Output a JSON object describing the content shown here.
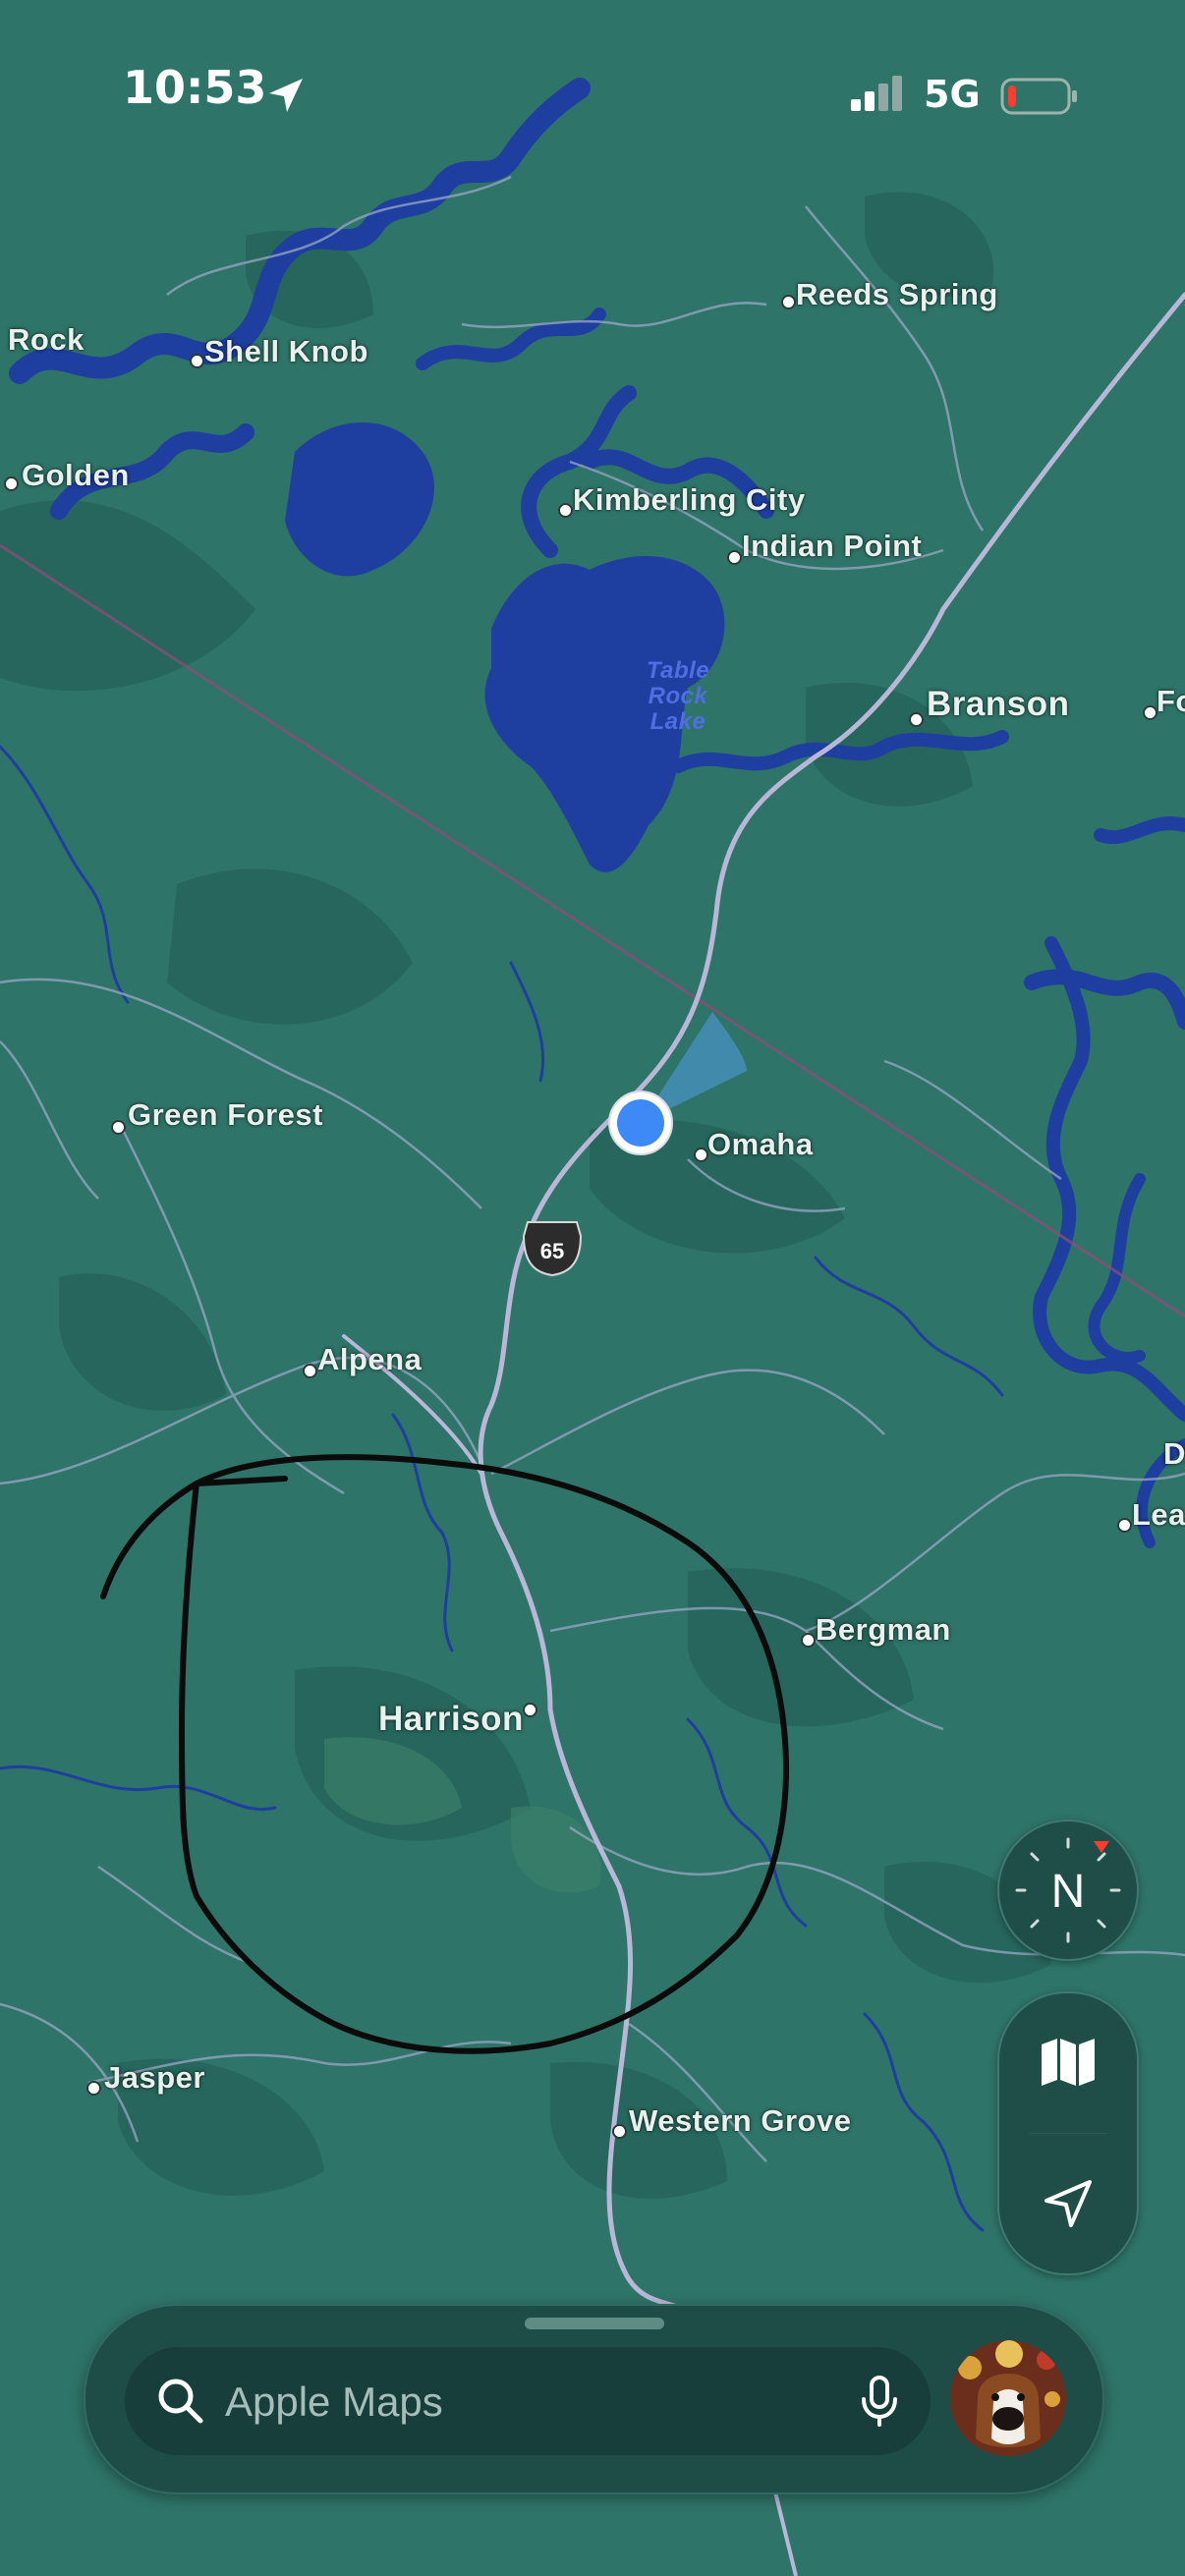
{
  "status_bar": {
    "time": "10:53",
    "network": "5G",
    "signal_bars_active": 2,
    "signal_bars_total": 4,
    "battery_level": 0.08,
    "battery_color": "#ff3b30"
  },
  "map": {
    "labels": {
      "rock": "Rock",
      "shell_knob": "Shell Knob",
      "golden": "Golden",
      "reeds_spring": "Reeds Spring",
      "kimberling_city": "Kimberling City",
      "indian_point": "Indian Point",
      "table_rock_lake": "Table Rock Lake",
      "branson": "Branson",
      "fo": "Fo",
      "green_forest": "Green Forest",
      "omaha": "Omaha",
      "alpena": "Alpena",
      "d": "D",
      "lea": "Lea",
      "bergman": "Bergman",
      "harrison": "Harrison",
      "jasper": "Jasper",
      "western_grove": "Western Grove"
    },
    "route_shield": "65",
    "colors": {
      "land": "#2f7468",
      "water": "#1e3ea0",
      "road": "#b8b7d8",
      "user_location": "#3d8af7"
    }
  },
  "controls": {
    "compass_label": "N",
    "map_mode_icon": "map-icon",
    "locate_icon": "location-arrow-icon"
  },
  "search": {
    "placeholder": "Apple Maps",
    "value": ""
  },
  "profile": {
    "avatar_icon": "avatar-photo"
  }
}
